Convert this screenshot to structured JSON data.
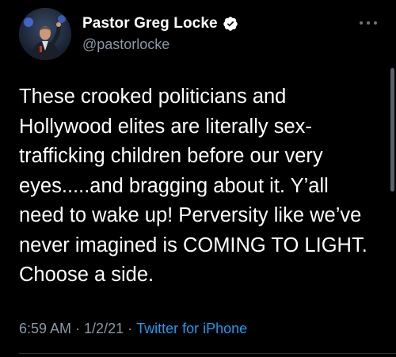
{
  "author": {
    "display_name": "Pastor Greg Locke",
    "handle": "@pastorlocke",
    "verified_icon": "verified-badge-icon",
    "avatar_icon": "profile-photo"
  },
  "tweet": {
    "text": "These crooked politicians and Hollywood elites are literally sex-trafficking children before our very eyes.....and bragging about it. Y’all need to wake up! Perversity like we’ve never imagined is COMING TO LIGHT. Choose a side.",
    "time": "6:59 AM",
    "separator": "·",
    "date": "1/2/21",
    "source": "Twitter for iPhone"
  },
  "colors": {
    "background": "#000000",
    "text": "#ffffff",
    "secondary": "#8b98a5",
    "link": "#1d9bf0",
    "divider": "#2f3336"
  }
}
